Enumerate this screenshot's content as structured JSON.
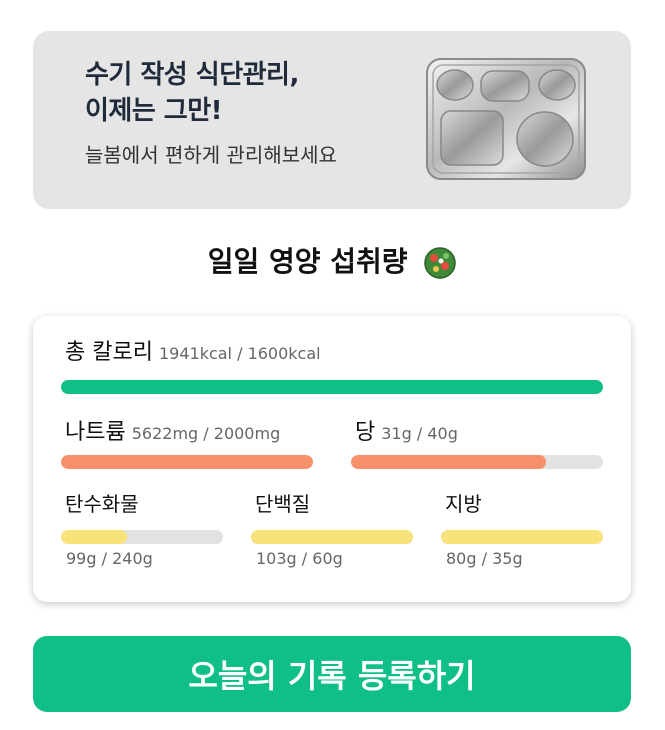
{
  "banner": {
    "title_line1": "수기 작성 식단관리,",
    "title_line2": "이제는 그만!",
    "subtitle": "늘봄에서 편하게 관리해보세요",
    "image_icon": "stainless-meal-tray-icon"
  },
  "section": {
    "title": "일일 영양 섭취량",
    "icon": "salad-bowl-icon"
  },
  "nutrition": {
    "calories": {
      "label": "총 칼로리",
      "value": "1941kcal / 1600kcal",
      "progress": 1.0,
      "color": "#10be87"
    },
    "sodium": {
      "label": "나트륨",
      "value": "5622mg / 2000mg",
      "progress": 1.0,
      "color": "#f7906b"
    },
    "sugar": {
      "label": "당",
      "value": "31g / 40g",
      "progress": 0.775,
      "color": "#f7906b"
    },
    "carbs": {
      "label": "탄수화물",
      "value": "99g / 240g",
      "progress": 0.41,
      "color": "#f8e27a"
    },
    "protein": {
      "label": "단백질",
      "value": "103g / 60g",
      "progress": 1.0,
      "color": "#f8e27a"
    },
    "fat": {
      "label": "지방",
      "value": "80g / 35g",
      "progress": 1.0,
      "color": "#f8e27a"
    }
  },
  "cta": {
    "label": "오늘의 기록 등록하기"
  }
}
